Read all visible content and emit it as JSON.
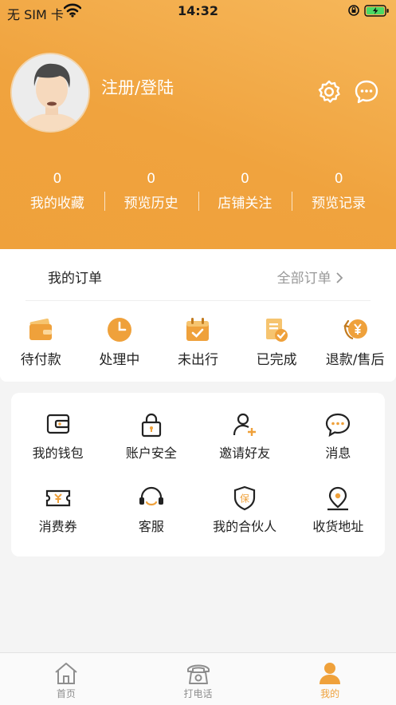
{
  "status_bar": {
    "carrier": "无 SIM 卡",
    "time": "14:32"
  },
  "profile": {
    "login_label": "注册/登陆"
  },
  "stats": [
    {
      "count": "0",
      "label": "我的收藏"
    },
    {
      "count": "0",
      "label": "预览历史"
    },
    {
      "count": "0",
      "label": "店铺关注"
    },
    {
      "count": "0",
      "label": "预览记录"
    }
  ],
  "orders": {
    "title": "我的订单",
    "all_label": "全部订单",
    "items": [
      {
        "label": "待付款",
        "icon": "wallet-icon"
      },
      {
        "label": "处理中",
        "icon": "clock-icon"
      },
      {
        "label": "未出行",
        "icon": "calendar-icon"
      },
      {
        "label": "已完成",
        "icon": "checklist-icon"
      },
      {
        "label": "退款/售后",
        "icon": "refund-icon"
      }
    ]
  },
  "tools": [
    {
      "label": "我的钱包",
      "icon": "wallet-icon"
    },
    {
      "label": "账户安全",
      "icon": "lock-icon"
    },
    {
      "label": "邀请好友",
      "icon": "add-user-icon"
    },
    {
      "label": "消息",
      "icon": "message-icon"
    },
    {
      "label": "消费券",
      "icon": "coupon-icon"
    },
    {
      "label": "客服",
      "icon": "headset-icon"
    },
    {
      "label": "我的合伙人",
      "icon": "shield-icon"
    },
    {
      "label": "收货地址",
      "icon": "location-icon"
    }
  ],
  "tabbar": [
    {
      "label": "首页",
      "icon": "home-icon",
      "active": false
    },
    {
      "label": "打电话",
      "icon": "phone-icon",
      "active": false
    },
    {
      "label": "我的",
      "icon": "profile-icon",
      "active": true
    }
  ],
  "colors": {
    "accent": "#efa13b",
    "header_light": "#f6b75a",
    "icon_dark": "#222222",
    "inactive_tab": "#8e8e8e"
  }
}
